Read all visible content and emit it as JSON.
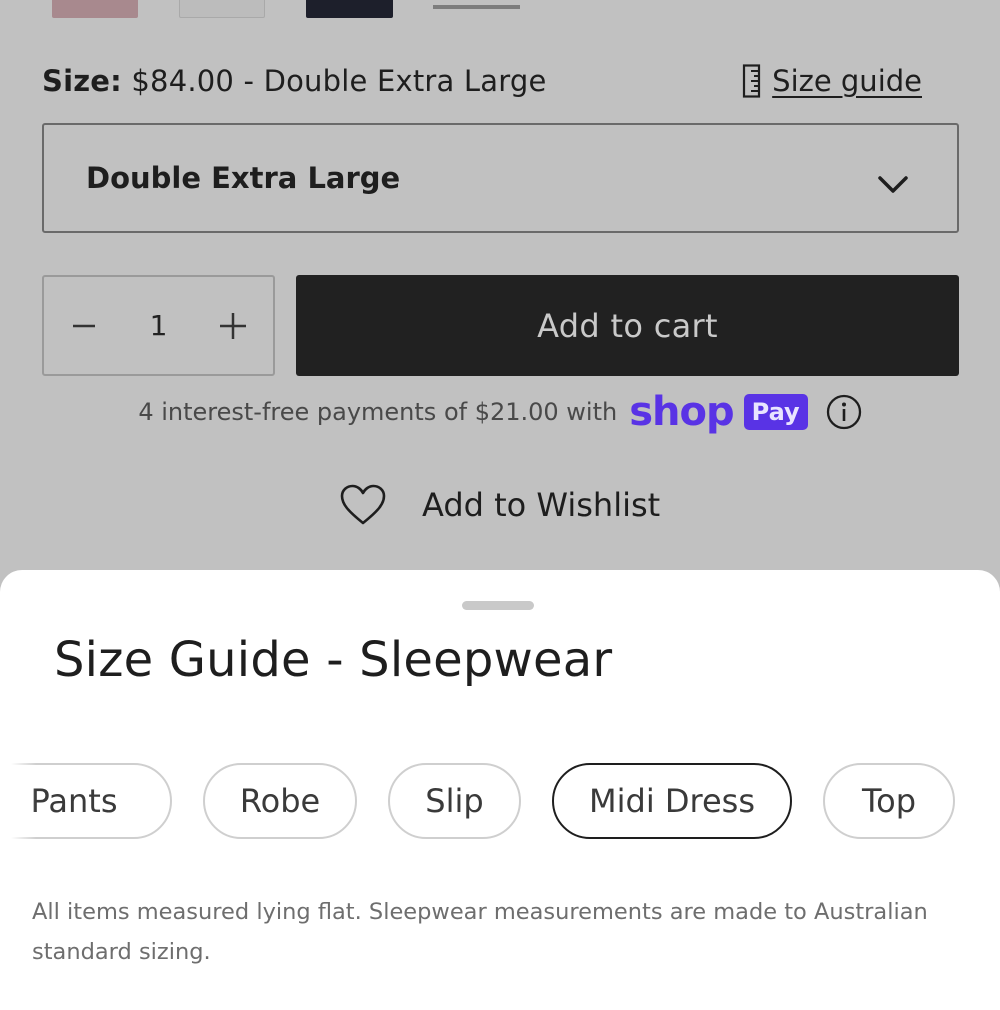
{
  "product": {
    "size_label": "Size:",
    "size_value": "$84.00 - Double Extra Large",
    "size_guide_link": "Size guide",
    "selected_size": "Double Extra Large",
    "quantity": "1",
    "add_to_cart": "Add to cart",
    "payments_text": "4 interest-free payments of $21.00 with",
    "shop_logo_text": "shop",
    "pay_badge_text": "Pay",
    "wishlist": "Add to Wishlist",
    "colors": {
      "shop_pay": "#5933e5",
      "cart_button": "#212121"
    }
  },
  "size_guide": {
    "title": "Size Guide - Sleepwear",
    "tabs": [
      {
        "label": "Pants",
        "active": false
      },
      {
        "label": "Robe",
        "active": false
      },
      {
        "label": "Slip",
        "active": false
      },
      {
        "label": "Midi Dress",
        "active": true
      },
      {
        "label": "Top",
        "active": false
      }
    ],
    "note": "All items measured lying flat. Sleepwear measurements are made to Australian standard sizing."
  },
  "icons": [
    "ruler-icon",
    "chevron-down-icon",
    "minus-icon",
    "plus-icon",
    "info-icon",
    "heart-icon"
  ]
}
